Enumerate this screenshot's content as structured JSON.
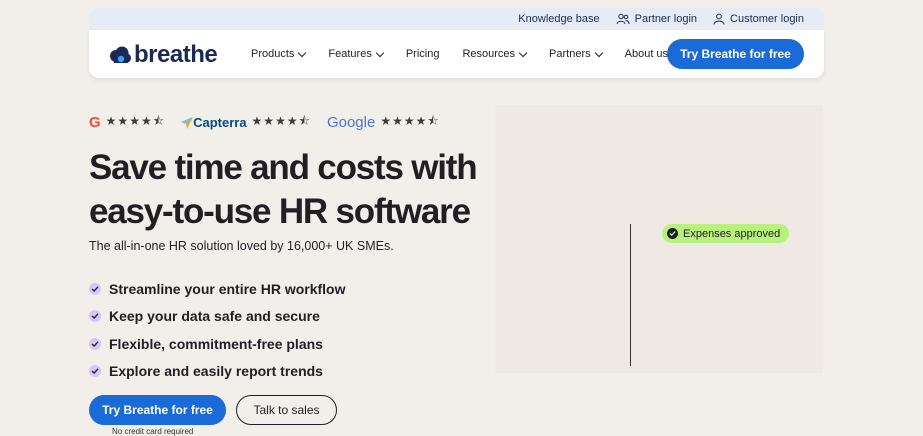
{
  "topbar": {
    "knowledge_base": "Knowledge base",
    "partner_login": "Partner login",
    "customer_login": "Customer login"
  },
  "nav": {
    "logo_text": "breathe",
    "items": [
      "Products",
      "Features",
      "Pricing",
      "Resources",
      "Partners",
      "About us"
    ],
    "cta": "Try Breathe for free"
  },
  "ratings": {
    "g2_mark": "G",
    "g2_stars": "★★★★⯪",
    "capterra_name": "Capterra",
    "capterra_stars": "★★★★⯪",
    "google_name": "Google",
    "google_stars": "★★★★⯪"
  },
  "hero": {
    "title_line1": "Save time and costs with",
    "title_line2": "easy-to-use HR software",
    "subtitle": "The all-in-one HR solution loved by 16,000+ UK SMEs.",
    "features": [
      "Streamline your entire HR workflow",
      "Keep your data safe and secure",
      "Flexible, commitment-free plans",
      "Explore and easily report trends"
    ],
    "primary_cta": "Try Breathe for free",
    "secondary_cta": "Talk to sales",
    "note": "No credit card required"
  },
  "visual": {
    "badge": "Expenses approved"
  },
  "colors": {
    "accent": "#1a6bd8",
    "brand_navy": "#1b2a55",
    "badge_green": "#b8f27c",
    "check_lilac": "#d7c7f2",
    "background": "#f2eee9"
  }
}
